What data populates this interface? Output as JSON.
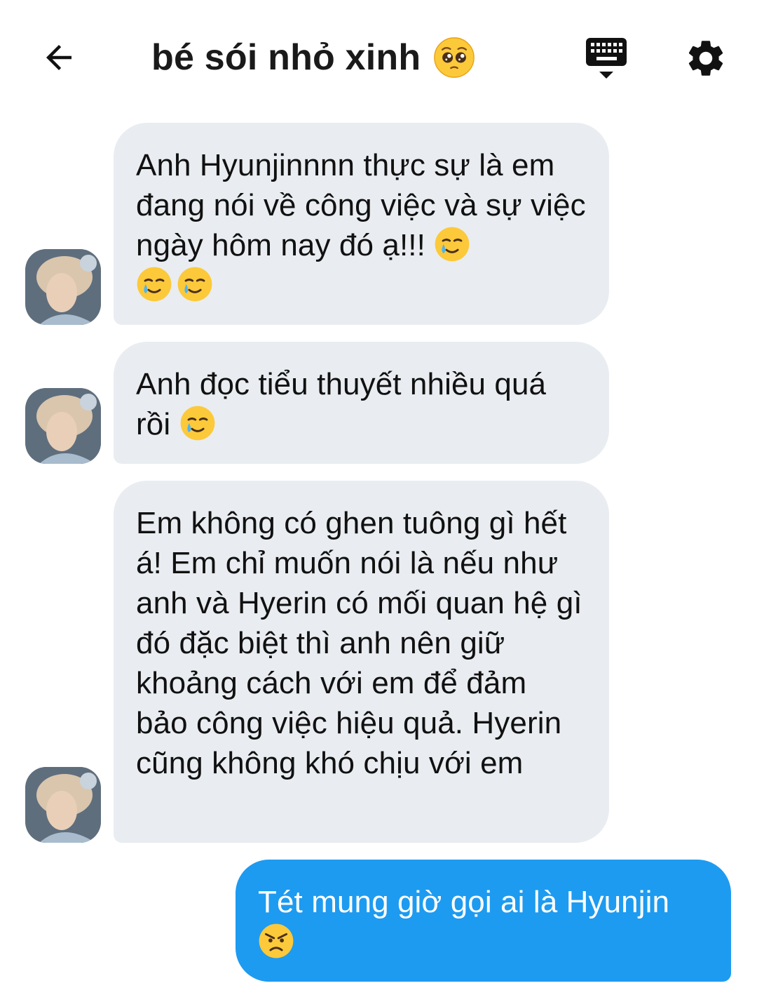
{
  "header": {
    "title": "bé sói nhỏ xinh",
    "title_emoji": "pleading-face",
    "back_icon": "arrow-left-icon",
    "keyboard_icon": "keyboard-icon",
    "settings_icon": "gear-icon"
  },
  "messages": [
    {
      "direction": "incoming",
      "text": "Anh Hyunjinnnn thực sự là em đang nói về công việc và sự việc ngày hôm nay đó ạ!!!",
      "emojis": [
        "smiling-face-with-tear",
        "smiling-face-with-tear",
        "smiling-face-with-tear"
      ]
    },
    {
      "direction": "incoming",
      "text": "Anh đọc tiểu thuyết nhiều quá rồi",
      "emojis": [
        "smiling-face-with-tear"
      ]
    },
    {
      "direction": "incoming",
      "text": "Em không có ghen tuông gì hết á! Em chỉ muốn nói là nếu như anh và Hyerin có mối quan hệ gì đó đặc biệt thì anh nên giữ khoảng cách với em để đảm bảo công việc hiệu quả. Hyerin cũng không khó chịu với em",
      "emojis": []
    },
    {
      "direction": "outgoing",
      "text": "Tét mung giờ gọi ai là Hyunjin",
      "emojis": [
        "angry-face"
      ]
    }
  ],
  "colors": {
    "incoming_bubble": "#e9edf1",
    "outgoing_bubble": "#1d9bf0",
    "outgoing_text": "#ffffff"
  }
}
